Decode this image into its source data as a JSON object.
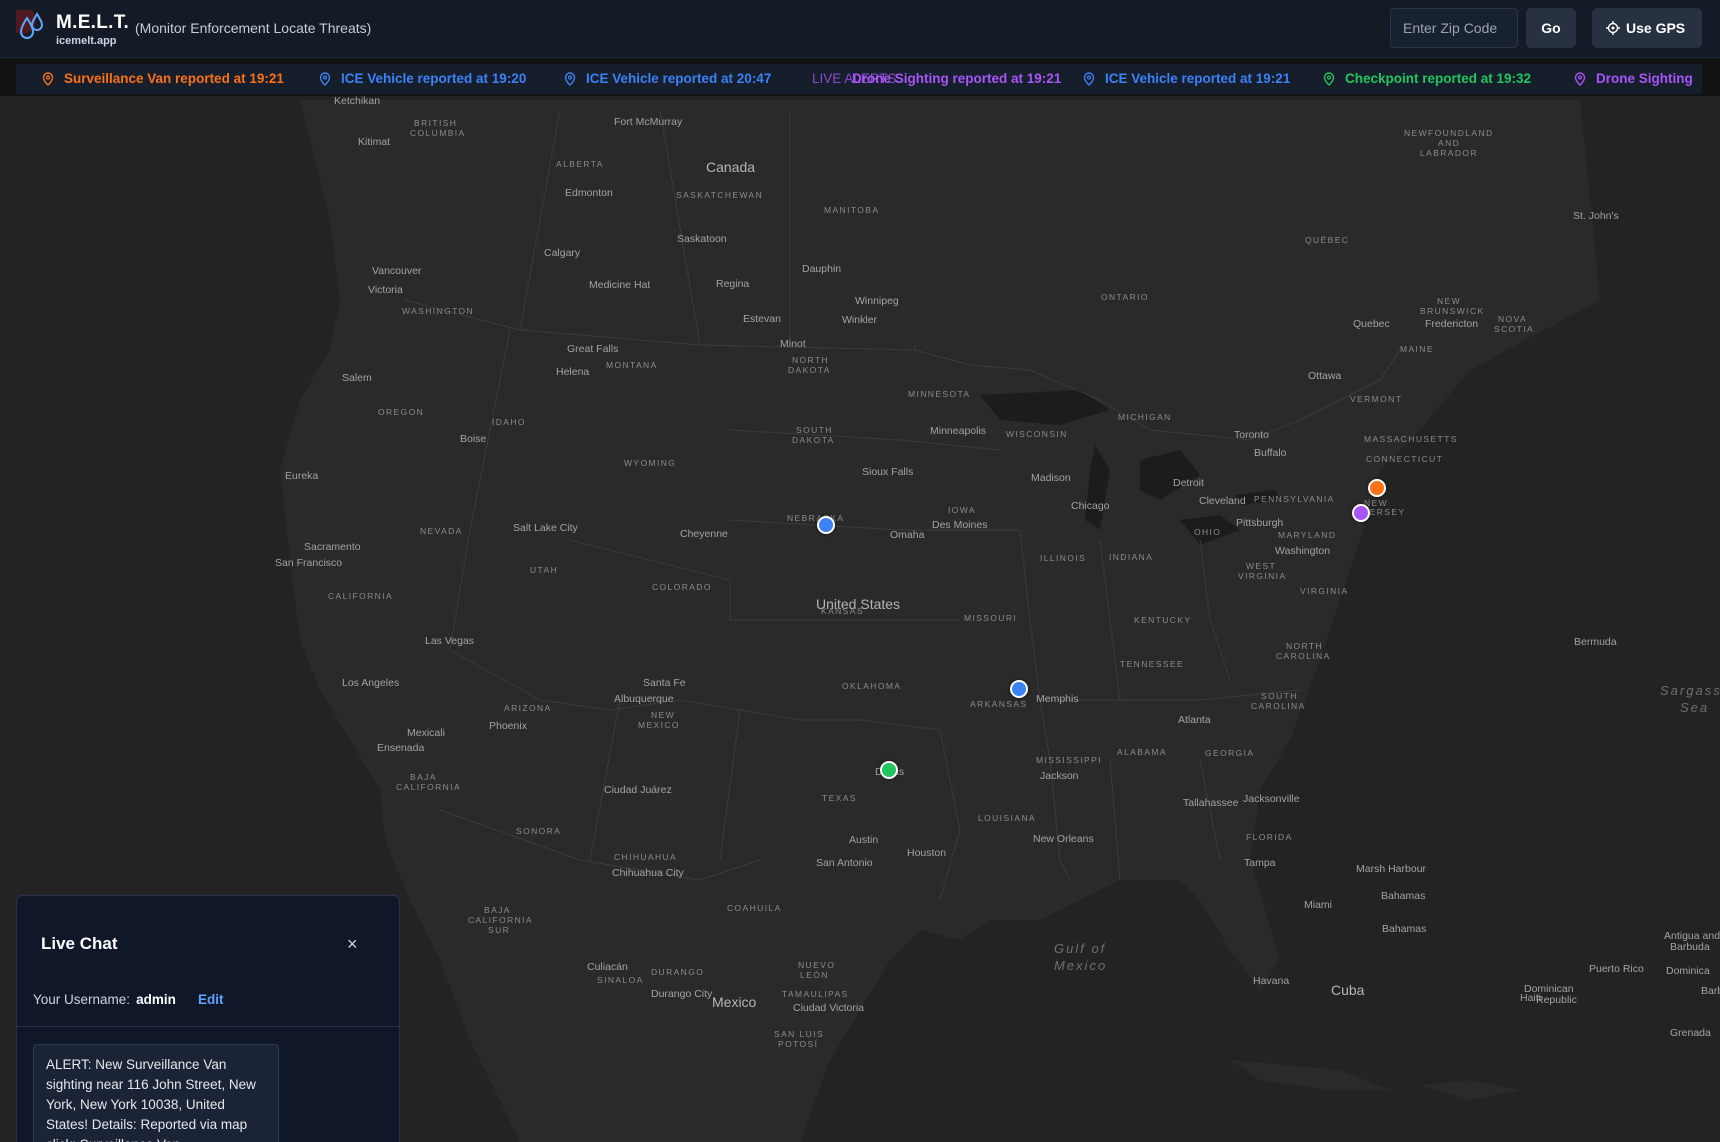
{
  "header": {
    "title": "M.E.L.T.",
    "subtitle": "icemelt.app",
    "expansion": "(Monitor Enforcement Locate Threats)",
    "zip_placeholder": "Enter Zip Code",
    "go_label": "Go",
    "gps_label": "Use GPS"
  },
  "ticker": {
    "live_label": "LIVE ALERTS",
    "items": [
      {
        "text": "Surveillance Van reported at 19:21",
        "color": "#f97316"
      },
      {
        "text": "ICE Vehicle reported at 19:20",
        "color": "#3b82f6"
      },
      {
        "text": "ICE Vehicle reported at 20:47",
        "color": "#3b82f6"
      },
      {
        "text": "Drone Sighting reported at 19:21",
        "color": "#a855f7"
      },
      {
        "text": "ICE Vehicle reported at 19:21",
        "color": "#3b82f6"
      },
      {
        "text": "Checkpoint reported at 19:32",
        "color": "#22c55e"
      },
      {
        "text": "Drone Sighting",
        "color": "#a855f7"
      }
    ]
  },
  "map": {
    "labels": {
      "canada": "Canada",
      "united_states": "United States",
      "mexico": "Mexico",
      "cuba": "Cuba",
      "gulf": "Gulf of",
      "gulf2": "Mexico",
      "sargasso": "Sargass",
      "sargasso2": "Sea",
      "ketchikan": "Ketchikan",
      "kitimat": "Kitimat",
      "bc": "BRITISH",
      "bc2": "COLUMBIA",
      "fort_mcmurray": "Fort McMurray",
      "alberta": "ALBERTA",
      "edmonton": "Edmonton",
      "saskatchewan": "SASKATCHEWAN",
      "manitoba": "MANITOBA",
      "saskatoon": "Saskatoon",
      "calgary": "Calgary",
      "vancouver": "Vancouver",
      "victoria": "Victoria",
      "medicine_hat": "Medicine Hat",
      "regina": "Regina",
      "dauphin": "Dauphin",
      "winnipeg": "Winnipeg",
      "estevan": "Estevan",
      "winkler": "Winkler",
      "ontario": "ONTARIO",
      "quebec_prov": "QUÉBEC",
      "quebec": "Quebec",
      "newfoundland": "NEWFOUNDLAND",
      "newfoundland2": "AND",
      "newfoundland3": "LABRADOR",
      "st_johns": "St. John's",
      "new_brunswick": "NEW",
      "new_brunswick2": "BRUNSWICK",
      "fredericton": "Fredericton",
      "nova_scotia": "NOVA",
      "nova_scotia2": "SCOTIA",
      "maine": "MAINE",
      "ottawa": "Ottawa",
      "toronto": "Toronto",
      "buffalo": "Buffalo",
      "vermont": "VERMONT",
      "massachusetts": "MASSACHUSETTS",
      "connecticut": "CONNECTICUT",
      "washington_state": "WASHINGTON",
      "salem": "Salem",
      "oregon": "OREGON",
      "idaho": "IDAHO",
      "boise": "Boise",
      "great_falls": "Great Falls",
      "helena": "Helena",
      "montana": "MONTANA",
      "minot": "Minot",
      "north_dakota": "NORTH",
      "north_dakota2": "DAKOTA",
      "south_dakota": "SOUTH",
      "south_dakota2": "DAKOTA",
      "minnesota": "MINNESOTA",
      "minneapolis": "Minneapolis",
      "wisconsin": "WISCONSIN",
      "michigan": "MICHIGAN",
      "wyoming": "WYOMING",
      "sioux_falls": "Sioux Falls",
      "madison": "Madison",
      "detroit": "Detroit",
      "cleveland": "Cleveland",
      "pennsylvania": "PENNSYLVANIA",
      "pittsburgh": "Pittsburgh",
      "new_jersey": "NEW",
      "new_jersey2": "JERSEY",
      "eureka": "Eureka",
      "nevada": "NEVADA",
      "salt_lake": "Salt Lake City",
      "cheyenne": "Cheyenne",
      "nebraska": "NEBRASKA",
      "iowa": "IOWA",
      "des_moines": "Des Moines",
      "omaha": "Omaha",
      "chicago": "Chicago",
      "ohio": "OHIO",
      "maryland": "MARYLAND",
      "washington_dc": "Washington",
      "sacramento": "Sacramento",
      "san_francisco": "San Francisco",
      "utah": "UTAH",
      "colorado": "COLORADO",
      "kansas": "KANSAS",
      "illinois": "ILLINOIS",
      "indiana": "INDIANA",
      "west_virginia": "WEST",
      "west_virginia2": "VIRGINIA",
      "virginia": "VIRGINIA",
      "california": "CALIFORNIA",
      "missouri": "MISSOURI",
      "kentucky": "KENTUCKY",
      "bermuda": "Bermuda",
      "las_vegas": "Las Vegas",
      "tennessee": "TENNESSEE",
      "north_carolina": "NORTH",
      "north_carolina2": "CAROLINA",
      "los_angeles": "Los Angeles",
      "santa_fe": "Santa Fe",
      "albuquerque": "Albuquerque",
      "oklahoma": "OKLAHOMA",
      "memphis": "Memphis",
      "arkansas": "ARKANSAS",
      "south_carolina": "SOUTH",
      "south_carolina2": "CAROLINA",
      "arizona": "ARIZONA",
      "new_mexico": "NEW",
      "new_mexico2": "MEXICO",
      "phoenix": "Phoenix",
      "atlanta": "Atlanta",
      "mexicali": "Mexicali",
      "ensenada": "Ensenada",
      "mississippi": "MISSISSIPPI",
      "alabama": "ALABAMA",
      "georgia": "GEORGIA",
      "jackson": "Jackson",
      "baja_california": "BAJA",
      "baja_california2": "CALIFORNIA",
      "ciudad_juarez": "Ciudad Juárez",
      "dallas": "Dallas",
      "texas": "TEXAS",
      "tallahassee": "Tallahassee",
      "jacksonville": "Jacksonville",
      "louisiana": "LOUISIANA",
      "sonora": "SONORA",
      "austin": "Austin",
      "new_orleans": "New Orleans",
      "florida": "FLORIDA",
      "houston": "Houston",
      "san_antonio": "San Antonio",
      "chihuahua_state": "CHIHUAHUA",
      "chihuahua_city": "Chihuahua City",
      "tampa": "Tampa",
      "marsh_harbour": "Marsh Harbour",
      "bahamas": "Bahamas",
      "bahamas2": "Bahamas",
      "miami": "Miami",
      "coahuila": "COAHUILA",
      "baja_sur": "BAJA",
      "baja_sur2": "CALIFORNIA",
      "baja_sur3": "SUR",
      "antigua": "Antigua and",
      "antigua2": "Barbuda",
      "culiacan": "Culiacán",
      "sinaloa": "SINALOA",
      "durango_state": "DURANGO",
      "nuevo_leon": "NUEVO",
      "nuevo_leon2": "LEÓN",
      "durango_city": "Durango City",
      "tamaulipas": "TAMAULIPAS",
      "ciudad_victoria": "Ciudad Victoria",
      "havana": "Havana",
      "haiti": "Haiti",
      "dominican": "Dominican",
      "dominican2": "Republic",
      "puerto_rico": "Puerto Rico",
      "dominica": "Dominica",
      "barbados": "Barb",
      "grenada": "Grenada",
      "san_luis": "SAN LUIS",
      "san_luis2": "POTOSÍ"
    },
    "markers": [
      {
        "type": "ICE Vehicle",
        "color": "#3b82f6",
        "location": "Nebraska"
      },
      {
        "type": "ICE Vehicle",
        "color": "#3b82f6",
        "location": "Arkansas"
      },
      {
        "type": "Checkpoint",
        "color": "#22c55e",
        "location": "Dallas"
      },
      {
        "type": "Surveillance Van",
        "color": "#f97316",
        "location": "New York"
      },
      {
        "type": "Drone Sighting",
        "color": "#a855f7",
        "location": "New Jersey"
      }
    ]
  },
  "chat": {
    "title": "Live Chat",
    "close": "×",
    "username_label": "Your Username:",
    "username": "admin",
    "edit_label": "Edit",
    "message": "ALERT: New Surveillance Van sighting near 116 John Street, New York, New York 10038, United States! Details: Reported via map click: Surveillance Van"
  }
}
